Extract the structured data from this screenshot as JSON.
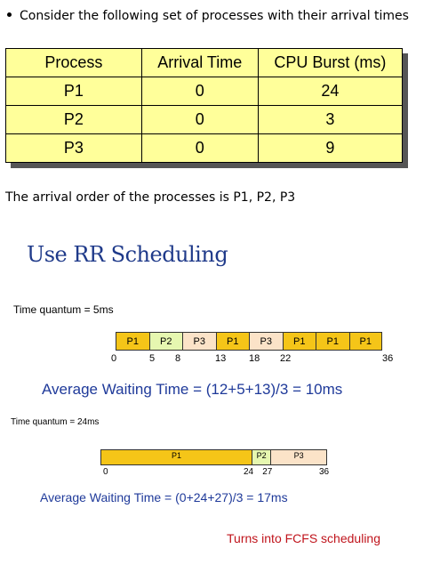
{
  "intro": "Consider the following set of processes with their arrival times",
  "table": {
    "headers": [
      "Process",
      "Arrival Time",
      "CPU Burst (ms)"
    ],
    "rows": [
      [
        "P1",
        "0",
        "24"
      ],
      [
        "P2",
        "0",
        "3"
      ],
      [
        "P3",
        "0",
        "9"
      ]
    ]
  },
  "arrival_order": "The arrival order of the processes is P1, P2, P3",
  "rr_title": "Use RR Scheduling",
  "example1": {
    "quantum_label": "Time quantum = 5ms",
    "segments": [
      {
        "label": "P1",
        "start": 0,
        "end": 5,
        "color": "#f5c518"
      },
      {
        "label": "P2",
        "start": 5,
        "end": 8,
        "color": "#e6f7b0"
      },
      {
        "label": "P3",
        "start": 8,
        "end": 13,
        "color": "#fbe3c8"
      },
      {
        "label": "P1",
        "start": 13,
        "end": 18,
        "color": "#f5c518"
      },
      {
        "label": "P3",
        "start": 18,
        "end": 22,
        "color": "#fbe3c8"
      },
      {
        "label": "P1",
        "start": 22,
        "end": 27,
        "color": "#f5c518"
      },
      {
        "label": "P1",
        "start": 27,
        "end": 32,
        "color": "#f5c518"
      },
      {
        "label": "P1",
        "start": 32,
        "end": 36,
        "color": "#f5c518"
      }
    ],
    "ticks": [
      "0",
      "5",
      "8",
      "13",
      "18",
      "22",
      "36"
    ],
    "average": "Average Waiting Time = (12+5+13)/3 = 10ms"
  },
  "example2": {
    "quantum_label": "Time quantum = 24ms",
    "segments": [
      {
        "label": "P1",
        "start": 0,
        "end": 24,
        "color": "#f5c518"
      },
      {
        "label": "P2",
        "start": 24,
        "end": 27,
        "color": "#e6f7b0"
      },
      {
        "label": "P3",
        "start": 27,
        "end": 36,
        "color": "#fbe3c8"
      }
    ],
    "ticks": [
      "0",
      "24",
      "27",
      "36"
    ],
    "average": "Average Waiting Time = (0+24+27)/3 = 17ms"
  },
  "note": "Turns into FCFS scheduling"
}
